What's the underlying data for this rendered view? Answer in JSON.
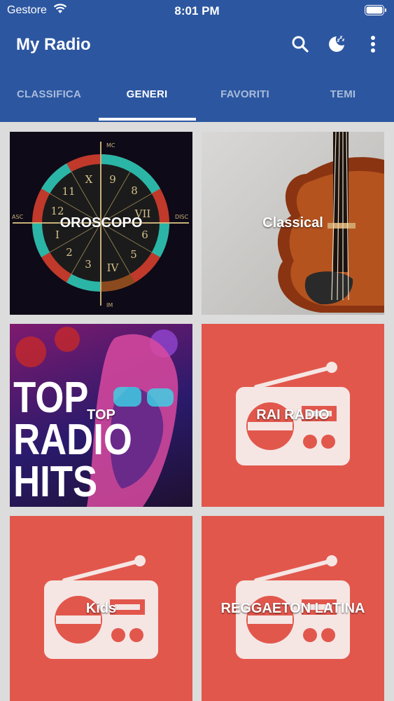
{
  "status_bar": {
    "carrier": "Gestore",
    "time": "8:01 PM"
  },
  "header": {
    "title": "My Radio"
  },
  "tabs": [
    {
      "label": "CLASSIFICA"
    },
    {
      "label": "GENERI"
    },
    {
      "label": "FAVORITI"
    },
    {
      "label": "TEMI"
    }
  ],
  "active_tab": "GENERI",
  "genres": [
    {
      "label": "OROSCOPO"
    },
    {
      "label": "Classical"
    },
    {
      "label": "TOP"
    },
    {
      "label": "RAI RADIO"
    },
    {
      "label": "Kids"
    },
    {
      "label": "REGGAETON LATINA"
    }
  ],
  "artwork": {
    "top_hits_lines": [
      "TOP",
      "RADIO",
      "HITS"
    ],
    "zodiac_labels": {
      "top": "MC",
      "left": "ASC",
      "right": "DISC",
      "bottom": "IM"
    },
    "zodiac_numbers": [
      "9",
      "8",
      "VII",
      "6",
      "5",
      "IV",
      "3",
      "2",
      "I",
      "12",
      "11",
      "X"
    ]
  },
  "colors": {
    "header": "#2c56a0",
    "tile_red": "#e2574c",
    "background": "#dcdcdc"
  }
}
